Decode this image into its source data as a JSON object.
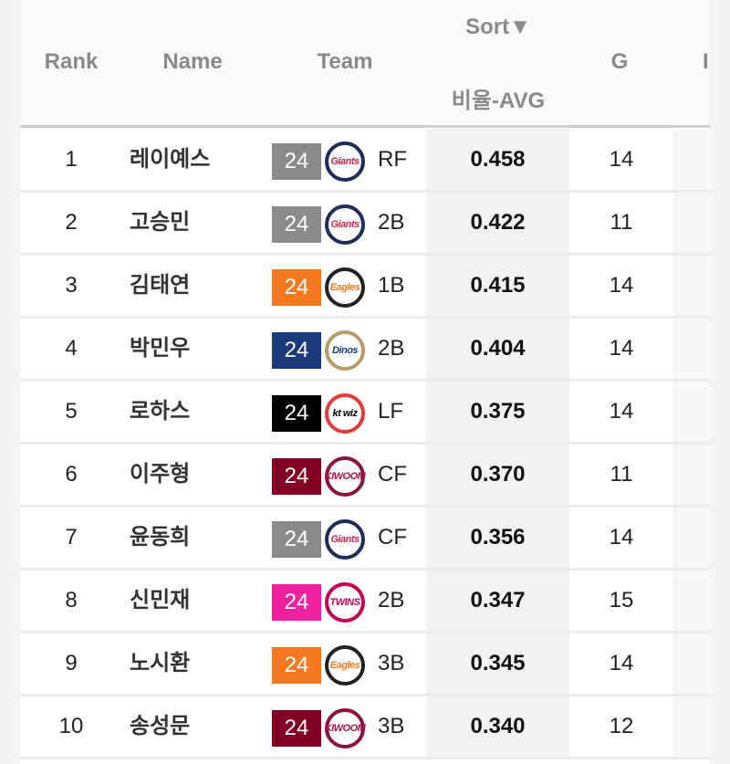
{
  "header": {
    "rank": "Rank",
    "name": "Name",
    "team": "Team",
    "sort_label": "Sort▼",
    "avg": "비율-AVG",
    "g": "G",
    "next_partial": "I"
  },
  "teams": {
    "giants": {
      "badge_color": "#8a8a8a",
      "logo_ring": "#1f2d5a",
      "logo_text": "Giants",
      "logo_text_color": "#d6254b"
    },
    "eagles": {
      "badge_color": "#f47920",
      "logo_ring": "#222222",
      "logo_text": "Eagles",
      "logo_text_color": "#f47920"
    },
    "dinos": {
      "badge_color": "#1b3a7a",
      "logo_ring": "#b89b6a",
      "logo_text": "Dinos",
      "logo_text_color": "#1b3a7a"
    },
    "ktwiz": {
      "badge_color": "#000000",
      "logo_ring": "#e53a35",
      "logo_text": "kt wiz",
      "logo_text_color": "#000000"
    },
    "kiwoom": {
      "badge_color": "#820024",
      "logo_ring": "#8a1538",
      "logo_text": "KIWOOM",
      "logo_text_color": "#a8174a"
    },
    "twins": {
      "badge_color": "#f0219e",
      "logo_ring": "#c30452",
      "logo_text": "TWINS",
      "logo_text_color": "#c30452"
    }
  },
  "rows": [
    {
      "rank": "1",
      "name": "레이예스",
      "team": "giants",
      "number": "24",
      "pos": "RF",
      "avg": "0.458",
      "g": "14"
    },
    {
      "rank": "2",
      "name": "고승민",
      "team": "giants",
      "number": "24",
      "pos": "2B",
      "avg": "0.422",
      "g": "11"
    },
    {
      "rank": "3",
      "name": "김태연",
      "team": "eagles",
      "number": "24",
      "pos": "1B",
      "avg": "0.415",
      "g": "14"
    },
    {
      "rank": "4",
      "name": "박민우",
      "team": "dinos",
      "number": "24",
      "pos": "2B",
      "avg": "0.404",
      "g": "14"
    },
    {
      "rank": "5",
      "name": "로하스",
      "team": "ktwiz",
      "number": "24",
      "pos": "LF",
      "avg": "0.375",
      "g": "14"
    },
    {
      "rank": "6",
      "name": "이주형",
      "team": "kiwoom",
      "number": "24",
      "pos": "CF",
      "avg": "0.370",
      "g": "11"
    },
    {
      "rank": "7",
      "name": "윤동희",
      "team": "giants",
      "number": "24",
      "pos": "CF",
      "avg": "0.356",
      "g": "14"
    },
    {
      "rank": "8",
      "name": "신민재",
      "team": "twins",
      "number": "24",
      "pos": "2B",
      "avg": "0.347",
      "g": "15"
    },
    {
      "rank": "9",
      "name": "노시환",
      "team": "eagles",
      "number": "24",
      "pos": "3B",
      "avg": "0.345",
      "g": "14"
    },
    {
      "rank": "10",
      "name": "송성문",
      "team": "kiwoom",
      "number": "24",
      "pos": "3B",
      "avg": "0.340",
      "g": "12"
    }
  ]
}
